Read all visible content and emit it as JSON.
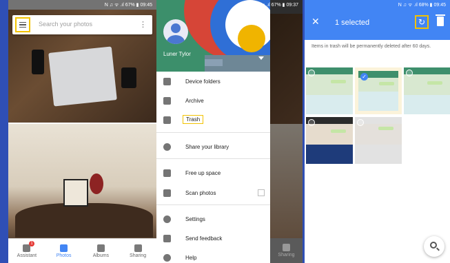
{
  "status": {
    "left": "▲ ✉ ▲ ●",
    "right_p1": "N ♫ ᯤ .ıl 67% ▮ 09:45",
    "right_p2": "N ♫ ᯤ .ıl 67% ▮ 09:37",
    "right_p3": "N ♫ ᯤ .ıl 68% ▮ 09:45"
  },
  "photos_screen": {
    "search_placeholder": "Search your photos",
    "nav": [
      {
        "label": "Assistant",
        "badge": "1"
      },
      {
        "label": "Photos"
      },
      {
        "label": "Albums"
      },
      {
        "label": "Sharing"
      }
    ]
  },
  "drawer": {
    "user_name": "Luner Tylor",
    "items": [
      {
        "label": "Device folders",
        "icon": "folder-icon"
      },
      {
        "label": "Archive",
        "icon": "archive-icon"
      },
      {
        "label": "Trash",
        "icon": "trash-icon"
      },
      {
        "label": "Share your library",
        "icon": "share-library-icon"
      },
      {
        "label": "Free up space",
        "icon": "phone-storage-icon"
      },
      {
        "label": "Scan photos",
        "icon": "scan-photos-icon"
      },
      {
        "label": "Settings",
        "icon": "settings-icon"
      },
      {
        "label": "Send feedback",
        "icon": "feedback-icon"
      },
      {
        "label": "Help",
        "icon": "help-icon"
      }
    ],
    "background_nav_label": "Sharing"
  },
  "trash_screen": {
    "title": "1 selected",
    "info": "Items in trash will be permanently deleted after 60 days.",
    "close_glyph": "✕",
    "restore_glyph": "↻",
    "check_glyph": "✓"
  },
  "colors": {
    "accent": "#4285f4",
    "highlight": "#f2c200",
    "background": "#2f4fb5"
  }
}
